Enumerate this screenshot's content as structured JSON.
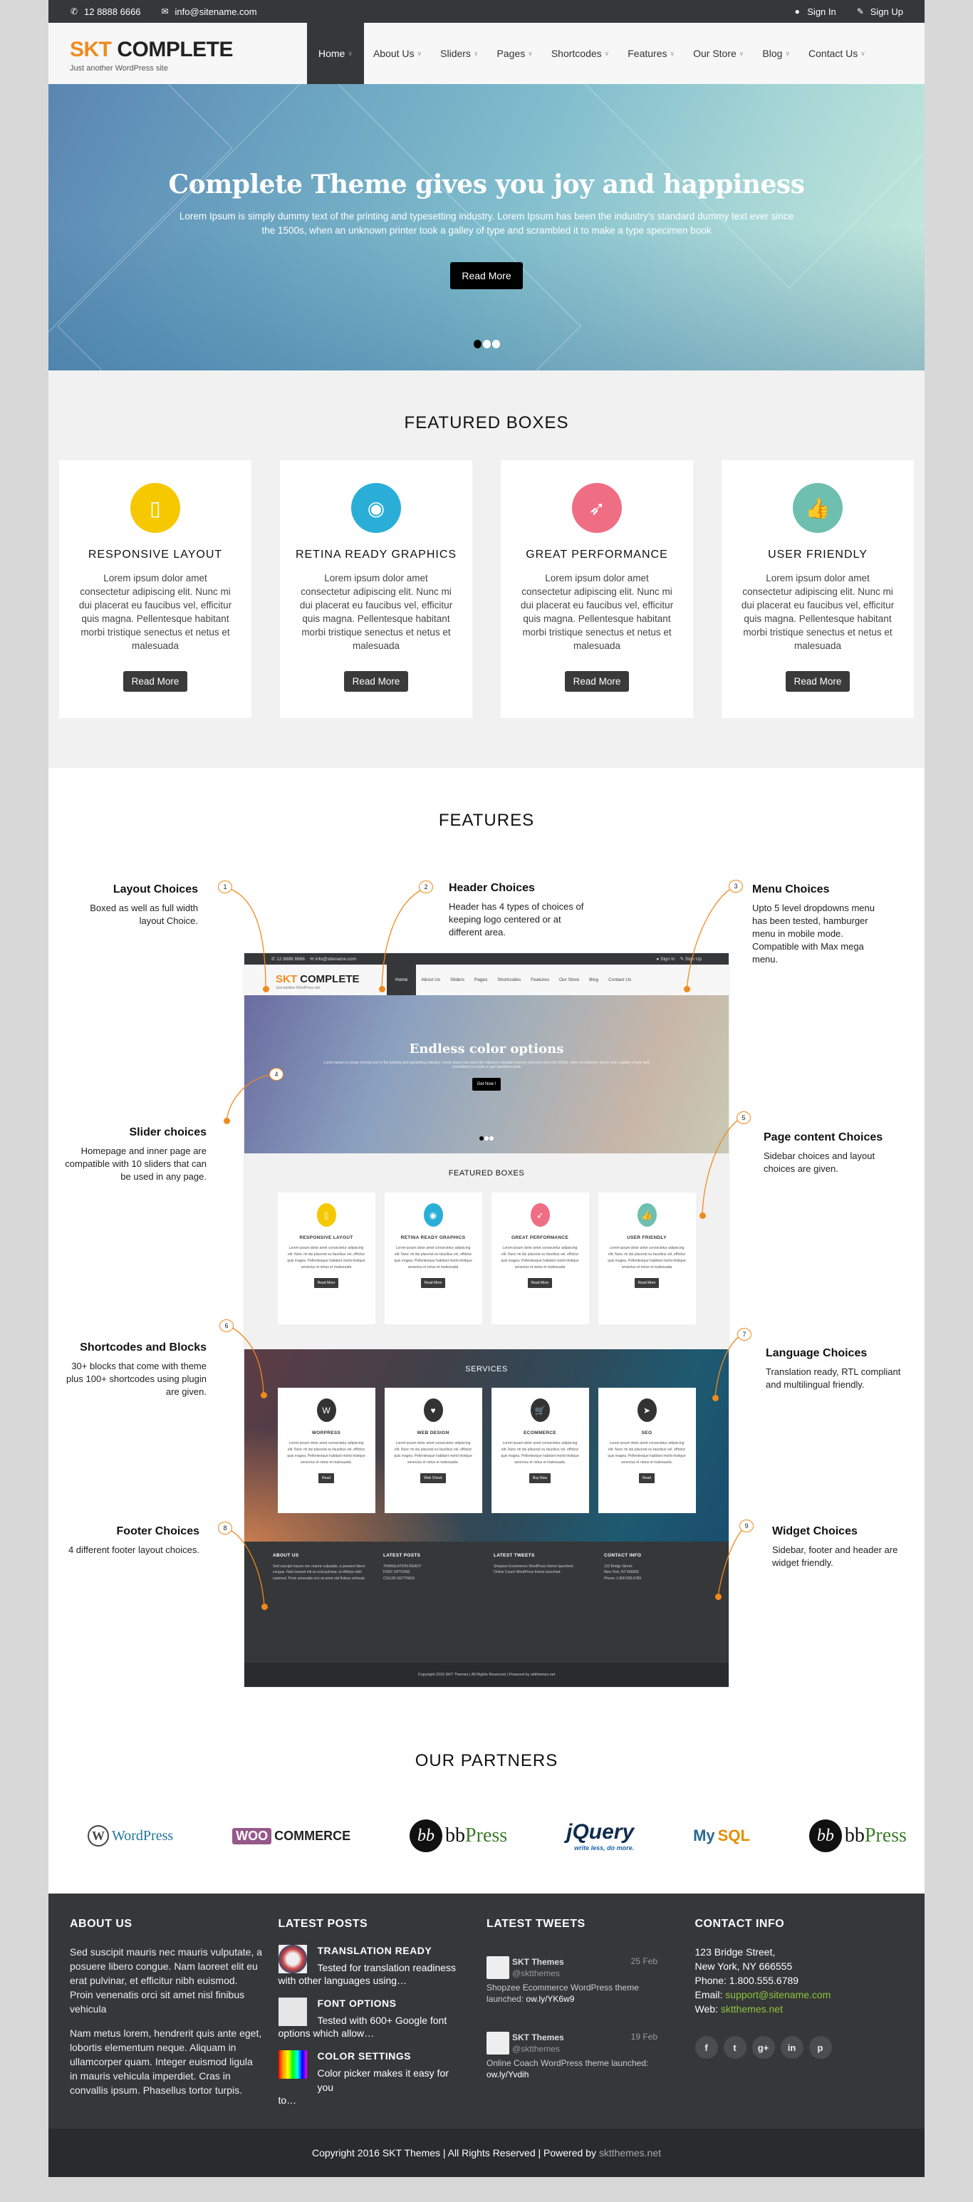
{
  "topbar": {
    "phone": "12 8888 6666",
    "email": "info@sitename.com",
    "sign_in": "Sign In",
    "sign_up": "Sign Up"
  },
  "header": {
    "brand_accent": "SKT",
    "brand_rest": " COMPLETE",
    "tagline": "Just another WordPress site",
    "nav": [
      "Home",
      "About Us",
      "Sliders",
      "Pages",
      "Shortcodes",
      "Features",
      "Our Store",
      "Blog",
      "Contact Us"
    ],
    "active": "Home"
  },
  "hero": {
    "title": "Complete Theme gives you joy and happiness",
    "text": "Lorem Ipsum is simply dummy text of the printing and typesetting industry. Lorem Ipsum has been the industry's standard dummy text ever since the 1500s, when an unknown printer took a galley of type and scrambled it to make a type specimen book",
    "button": "Read More",
    "slides": 3,
    "active_slide": 1
  },
  "featured": {
    "title": "FEATURED BOXES",
    "boxes": [
      {
        "title": "RESPONSIVE LAYOUT",
        "icon": "mobile-icon",
        "color": "#f5c800",
        "text": "Lorem ipsum dolor amet consectetur adipiscing elit. Nunc mi dui placerat eu faucibus vel, efficitur quis magna. Pellentesque habitant morbi tristique senectus et netus et malesuada",
        "button": "Read More"
      },
      {
        "title": "RETINA READY GRAPHICS",
        "icon": "eye-icon",
        "color": "#2aaed8",
        "text": "Lorem ipsum dolor amet consectetur adipiscing elit. Nunc mi dui placerat eu faucibus vel, efficitur quis magna. Pellentesque habitant morbi tristique senectus et netus et malesuada",
        "button": "Read More"
      },
      {
        "title": "GREAT PERFORMANCE",
        "icon": "rocket-icon",
        "color": "#ef6e84",
        "text": "Lorem ipsum dolor amet consectetur adipiscing elit. Nunc mi dui placerat eu faucibus vel, efficitur quis magna. Pellentesque habitant morbi tristique senectus et netus et malesuada",
        "button": "Read More"
      },
      {
        "title": "USER FRIENDLY",
        "icon": "thumbs-up-icon",
        "color": "#6fbfb0",
        "text": "Lorem ipsum dolor amet consectetur adipiscing elit. Nunc mi dui placerat eu faucibus vel, efficitur quis magna. Pellentesque habitant morbi tristique senectus et netus et malesuada",
        "button": "Read More"
      }
    ]
  },
  "features": {
    "title": "FEATURES",
    "annotations": [
      {
        "n": "1",
        "title": "Layout Choices",
        "text": "Boxed as well as full width layout Choice."
      },
      {
        "n": "2",
        "title": "Header Choices",
        "text": "Header has 4 types of choices of keeping logo centered or at different area."
      },
      {
        "n": "3",
        "title": "Menu Choices",
        "text": "Upto 5 level dropdowns menu has been tested, hamburger menu in mobile mode. Compatible with Max mega menu."
      },
      {
        "n": "4",
        "title": "Slider choices",
        "text": "Homepage and inner page are compatible with 10 sliders that can be used in any page."
      },
      {
        "n": "5",
        "title": "Page content Choices",
        "text": "Sidebar choices and layout choices are given."
      },
      {
        "n": "6",
        "title": "Shortcodes and Blocks",
        "text": "30+ blocks that come with theme plus 100+ shortcodes using plugin are given."
      },
      {
        "n": "7",
        "title": "Language Choices",
        "text": "Translation ready, RTL compliant and multilingual friendly."
      },
      {
        "n": "8",
        "title": "Footer Choices",
        "text": "4 different footer layout choices."
      },
      {
        "n": "9",
        "title": "Widget Choices",
        "text": "Sidebar, footer and header are widget friendly."
      }
    ],
    "mockup": {
      "phone": "12 8888 6666",
      "email": "info@sitename.com",
      "sign_in": "Sign In",
      "sign_up": "Sign Up",
      "brand_accent": "SKT",
      "brand_rest": " COMPLETE",
      "tagline": "Just another WordPress site",
      "nav": [
        "Home",
        "About Us",
        "Sliders",
        "Pages",
        "Shortcodes",
        "Features",
        "Our Store",
        "Blog",
        "Contact Us"
      ],
      "hero_title": "Endless color options",
      "hero_text": "Lorem Ipsum is simply dummy text of the printing and typesetting industry. Lorem Ipsum has been the industry's standard dummy text ever since the 1500s, when an unknown printer took a galley of type and scrambled it to make a type specimen book",
      "hero_button": "Get Now !",
      "featured_title": "FEATURED BOXES",
      "featured": [
        {
          "title": "RESPONSIVE LAYOUT",
          "color": "#f5c800",
          "button": "Read More"
        },
        {
          "title": "RETINA READY GRAPHICS",
          "color": "#2aaed8",
          "button": "Read More"
        },
        {
          "title": "GREAT PERFORMANCE",
          "color": "#ef6e84",
          "button": "Read More"
        },
        {
          "title": "USER FRIENDLY",
          "color": "#6fbfb0",
          "button": "Read More"
        }
      ],
      "featured_text": "Lorem ipsum dolor amet consectetur adipiscing elit. Nunc mi dui placerat eu faucibus vel, efficitur quis magna. Pellentesque habitant morbi tristique senectus et netus et malesuada",
      "services_title": "SERVICES",
      "services": [
        {
          "title": "WORPRESS",
          "icon": "wordpress-icon",
          "button": "Read"
        },
        {
          "title": "WEB DESIGN",
          "icon": "heart-icon",
          "button": "Web Check"
        },
        {
          "title": "ECOMMERCE",
          "icon": "cart-icon",
          "button": "Buy Now"
        },
        {
          "title": "SEO",
          "icon": "location-arrow-icon",
          "button": "Read"
        }
      ],
      "services_text": "Lorem ipsum dolor amet consectetur adipiscing elit. Nunc mi dui placerat eu faucibus vel, efficitur quis magna. Pellentesque habitant morbi tristique senectus et netus et malesuada.",
      "footer_cols": [
        "ABOUT US",
        "LATEST POSTS",
        "LATEST TWEETS",
        "CONTACT INFO"
      ],
      "copyright": "Copyright 2016 SKT Themes | All Rights Reserved | Powered by sktthemes.net"
    }
  },
  "partners": {
    "title": "OUR PARTNERS",
    "logos": [
      "WordPress",
      "WooCommerce",
      "bbPress",
      "jQuery",
      "MySQL",
      "bbPress"
    ]
  },
  "footer": {
    "about": {
      "title": "ABOUT US",
      "p1": "Sed suscipit mauris nec mauris vulputate, a posuere libero congue. Nam laoreet elit eu erat pulvinar, et efficitur nibh euismod. Proin venenatis orci sit amet nisl finibus vehicula",
      "p2": "Nam metus lorem, hendrerit quis ante eget, lobortis elementum neque. Aliquam in ullamcorper quam. Integer euismod ligula in mauris vehicula imperdiet. Cras in convallis ipsum. Phasellus tortor turpis."
    },
    "posts": {
      "title": "LATEST POSTS",
      "items": [
        {
          "title": "TRANSLATION READY",
          "lead": "Tested for translation readiness",
          "rest": "with other languages using…"
        },
        {
          "title": "FONT OPTIONS",
          "lead": "Tested with 600+ Google font",
          "rest": "options which allow…"
        },
        {
          "title": "COLOR SETTINGS",
          "lead": "Color picker makes it easy for you",
          "rest": "to…"
        }
      ]
    },
    "tweets": {
      "title": "LATEST TWEETS",
      "items": [
        {
          "name": "SKT Themes",
          "handle": "@sktthemes",
          "date": "25 Feb",
          "text": "Shopzee Ecommerce WordPress theme launched: ",
          "link": "ow.ly/YK6w9"
        },
        {
          "name": "SKT Themes",
          "handle": "@sktthemes",
          "date": "19 Feb",
          "text": "Online Coach WordPress theme launched: ",
          "link": "ow.ly/Yvdih"
        }
      ]
    },
    "contact": {
      "title": "CONTACT INFO",
      "street": "123 Bridge Street,",
      "city": "New York, NY 666555",
      "phone": "Phone: 1.800.555.6789",
      "email_label": "Email: ",
      "email": "support@sitename.com",
      "web_label": "Web: ",
      "web": "sktthemes.net",
      "social": [
        "facebook",
        "twitter",
        "google-plus",
        "linkedin",
        "pinterest"
      ]
    },
    "copyright": "Copyright 2016 SKT Themes | All Rights Reserved | Powered by ",
    "copyright_link": "sktthemes.net"
  },
  "colors": {
    "accent": "#f08a1c",
    "dark": "#363738",
    "link_green": "#8cc63f"
  }
}
